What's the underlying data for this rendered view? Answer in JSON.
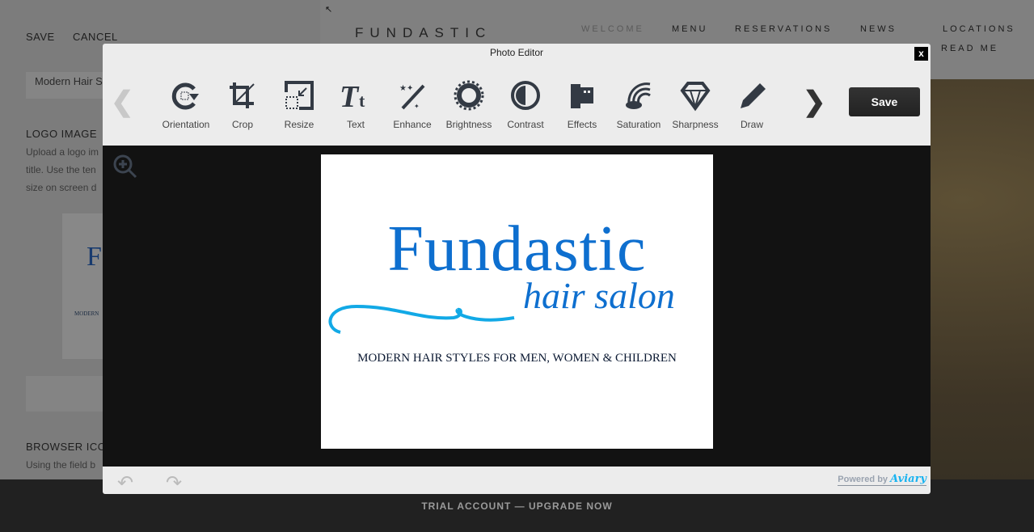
{
  "sidebar": {
    "save": "SAVE",
    "cancel": "CANCEL",
    "field_value": "Modern Hair S",
    "logo_heading": "LOGO IMAGE",
    "logo_desc": "Upload a logo im title. Use the ten size on screen d",
    "thumb_letter": "F",
    "thumb_tag": "MODERN",
    "browser_heading": "BROWSER ICO",
    "browser_desc": "Using the field b"
  },
  "site": {
    "brand": "FUNDASTIC",
    "nav": [
      "WELCOME",
      "MENU",
      "RESERVATIONS",
      "NEWS",
      "LOCATIONS",
      "READ ME"
    ]
  },
  "footer": {
    "trial": "TRIAL ACCOUNT — UPGRADE NOW"
  },
  "editor": {
    "title": "Photo Editor",
    "close": "x",
    "save": "Save",
    "powered_by": "Powered by",
    "aviary": "Aviary",
    "tools": [
      {
        "label": "Orientation",
        "icon": "rotate-icon"
      },
      {
        "label": "Crop",
        "icon": "crop-icon"
      },
      {
        "label": "Resize",
        "icon": "resize-icon"
      },
      {
        "label": "Text",
        "icon": "text-icon"
      },
      {
        "label": "Enhance",
        "icon": "magic-wand-icon"
      },
      {
        "label": "Brightness",
        "icon": "sun-icon"
      },
      {
        "label": "Contrast",
        "icon": "contrast-icon"
      },
      {
        "label": "Effects",
        "icon": "film-icon"
      },
      {
        "label": "Saturation",
        "icon": "rainbow-icon"
      },
      {
        "label": "Sharpness",
        "icon": "diamond-icon"
      },
      {
        "label": "Draw",
        "icon": "pencil-icon"
      }
    ],
    "image": {
      "title": "Fundastic",
      "subtitle": "hair salon",
      "tagline": "MODERN HAIR STYLES FOR MEN, WOMEN & CHILDREN"
    },
    "accent": "#0e6fcf"
  }
}
